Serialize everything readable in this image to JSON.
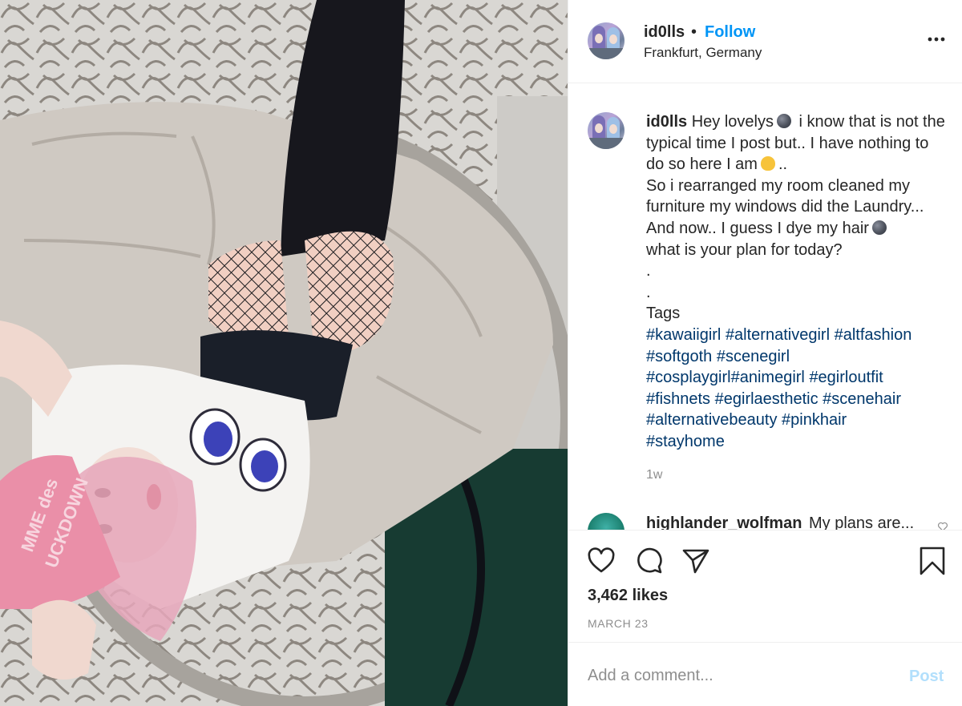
{
  "post": {
    "author": "id0lls",
    "separator": "•",
    "follow_label": "Follow",
    "location": "Frankfurt, Germany",
    "more_icon": "more-options-icon"
  },
  "caption": {
    "username": "id0lls",
    "part1": "Hey lovelys",
    "part2": "i know that is not the typical time I post but.. I have nothing to do so here I am",
    "part3": "..",
    "part4": "So i rearranged my room cleaned my furniture my windows did the Laundry... And now.. I guess I dye my hair",
    "part5": "what is your plan for today?",
    "dot1": ".",
    "dot2": ".",
    "tags_label": "Tags",
    "hashtags": [
      "#kawaiigirl",
      "#alternativegirl",
      "#altfashion",
      "#softgoth",
      "#scenegirl",
      "#cosplaygirl#animegirl",
      "#egirloutfit",
      "#fishnets",
      "#egirlaesthetic",
      "#scenehair",
      "#alternativebeauty",
      "#pinkhair",
      "#stayhome"
    ],
    "time_ago": "1w"
  },
  "next_comment": {
    "username": "highlander_wolfman",
    "text": "My plans are..."
  },
  "actions": {
    "like_icon": "heart-icon",
    "comment_icon": "comment-icon",
    "share_icon": "share-icon",
    "save_icon": "bookmark-icon"
  },
  "likes": "3,462 likes",
  "date": "MARCH 23",
  "add_comment": {
    "placeholder": "Add a comment...",
    "post_label": "Post"
  },
  "colors": {
    "follow_blue": "#0095f6",
    "hashtag_blue": "#00376b",
    "post_disabled": "#b2dffc",
    "muted_text": "#8e8e8e"
  }
}
